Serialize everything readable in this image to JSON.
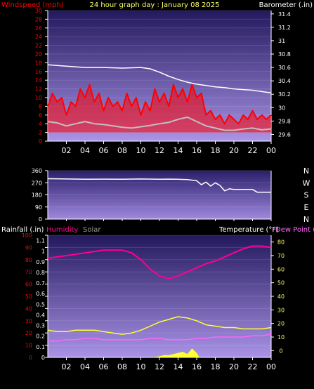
{
  "header": {
    "left_label": "Windspeed (mph)",
    "title": "24 hour graph day : January 08 2025",
    "right_label": "Barometer (.in)"
  },
  "middle_header": {
    "left_label": "Rainfall (.in)",
    "humidity_label": "Humidity",
    "solar_label": "Solar",
    "temperature_label": "Temperature (°F)",
    "dewpoint_label": "Dew Point ("
  },
  "x_tick_labels": [
    "02",
    "04",
    "06",
    "08",
    "10",
    "12",
    "14",
    "16",
    "18",
    "20",
    "22",
    "00"
  ],
  "colors": {
    "plot_top": "#23195e",
    "plot_bottom": "#a993e6",
    "wind_gust": "#ff0000",
    "wind_avg": "#c0c0c0",
    "barometer": "#ffffff",
    "direction": "#ffffff",
    "temperature": "#ff0090",
    "humidity_axis": "#ff0000",
    "dewpoint": "#ff66ff",
    "solar": "#ffff33",
    "title": "#ffff66"
  },
  "chart_data": [
    {
      "type": "line",
      "name": "wind-barometer",
      "x_range_hours": [
        0,
        24
      ],
      "left_axis": {
        "title": "Windspeed (mph)",
        "ticks": [
          "30",
          "28",
          "26",
          "24",
          "22",
          "20",
          "18",
          "16",
          "14",
          "12",
          "10",
          "8",
          "6",
          "4",
          "2",
          "0"
        ],
        "ylim": [
          0,
          30
        ]
      },
      "right_axis": {
        "title": "Barometer (.in)",
        "ticks": [
          "31.4",
          "31.2",
          "31",
          "30.8",
          "30.6",
          "30.4",
          "30.2",
          "30",
          "29.8",
          "29.6"
        ],
        "ylim": [
          29.5,
          31.45
        ]
      },
      "series": [
        {
          "label": "gust",
          "x": [
            0,
            0.5,
            1,
            1.5,
            2,
            2.5,
            3,
            3.5,
            4,
            4.5,
            5,
            5.5,
            6,
            6.5,
            7,
            7.5,
            8,
            8.5,
            9,
            9.5,
            10,
            10.5,
            11,
            11.5,
            12,
            12.5,
            13,
            13.5,
            14,
            14.5,
            15,
            15.5,
            16,
            16.5,
            17,
            17.5,
            18,
            18.5,
            19,
            19.5,
            20,
            20.5,
            21,
            21.5,
            22,
            22.5,
            23,
            23.5,
            24
          ],
          "y": [
            8,
            11,
            9,
            10,
            6,
            9,
            8,
            12,
            10,
            13,
            9,
            11,
            7,
            10,
            8,
            9,
            7,
            11,
            8,
            10,
            6,
            9,
            7,
            12,
            9,
            11,
            8,
            13,
            10,
            12,
            9,
            13,
            10,
            11,
            6,
            7,
            5,
            6,
            4,
            6,
            5,
            4,
            6,
            5,
            7,
            5,
            6,
            5,
            6
          ]
        },
        {
          "label": "average",
          "x": [
            0,
            1,
            2,
            3,
            4,
            5,
            6,
            7,
            8,
            9,
            10,
            11,
            12,
            13,
            14,
            15,
            16,
            17,
            18,
            19,
            20,
            21,
            22,
            23,
            24
          ],
          "y": [
            4.5,
            4.2,
            3.5,
            4,
            4.5,
            4,
            3.8,
            3.5,
            3.2,
            3,
            3.3,
            3.6,
            4,
            4.3,
            5,
            5.5,
            4.5,
            3.5,
            3,
            2.5,
            2.5,
            2.8,
            3,
            2.6,
            2.8
          ]
        },
        {
          "label": "barometer",
          "x": [
            0,
            2,
            4,
            6,
            8,
            10,
            11,
            12,
            13,
            14,
            15,
            16,
            17,
            18,
            19,
            20,
            21,
            22,
            23,
            24
          ],
          "y": [
            30.64,
            30.62,
            30.6,
            30.6,
            30.59,
            30.6,
            30.58,
            30.53,
            30.47,
            30.42,
            30.38,
            30.35,
            30.33,
            30.31,
            30.3,
            30.28,
            30.27,
            30.26,
            30.24,
            30.22
          ]
        }
      ]
    },
    {
      "type": "line",
      "name": "wind-direction",
      "x_range_hours": [
        0,
        24
      ],
      "left_axis": {
        "ticks": [
          "360",
          "270",
          "180",
          "90",
          "0"
        ],
        "ylim": [
          0,
          360
        ]
      },
      "right_axis": {
        "ticks": [
          "N",
          "W",
          "S",
          "E",
          "N"
        ]
      },
      "series": [
        {
          "label": "direction",
          "x": [
            0,
            2,
            4,
            6,
            8,
            10,
            12,
            13,
            14,
            15,
            16,
            16.5,
            17,
            17.5,
            18,
            18.5,
            19,
            19.5,
            20,
            21,
            22,
            22.5,
            23,
            24
          ],
          "y": [
            300,
            298,
            296,
            297,
            296,
            298,
            296,
            297,
            296,
            294,
            285,
            255,
            275,
            245,
            270,
            250,
            210,
            225,
            220,
            220,
            220,
            200,
            200,
            200
          ]
        }
      ]
    },
    {
      "type": "line",
      "name": "rain-humidity-solar-temperature",
      "x_range_hours": [
        0,
        24
      ],
      "left_axis": {
        "title": "Rainfall (.in) / Humidity",
        "outer_ticks": [
          "100",
          "90",
          "80",
          "70",
          "60",
          "50",
          "40",
          "30",
          "20",
          "10",
          "0"
        ],
        "inner_ticks": [
          "1.1",
          "1",
          "0.9",
          "0.8",
          "0.7",
          "0.6",
          "0.5",
          "0.4",
          "0.3",
          "0.2",
          "0.1",
          "0"
        ],
        "ylim": [
          0,
          100
        ]
      },
      "right_axis": {
        "title": "Temperature (°F)",
        "ticks": [
          "80",
          "70",
          "60",
          "50",
          "40",
          "30",
          "20",
          "10",
          "0"
        ],
        "ylim": [
          -5,
          85
        ]
      },
      "series": [
        {
          "label": "temperature",
          "x": [
            0,
            1,
            2,
            3,
            4,
            5,
            6,
            7,
            8,
            9,
            10,
            11,
            12,
            13,
            14,
            15,
            16,
            17,
            18,
            19,
            20,
            21,
            22,
            23,
            24
          ],
          "y": [
            68,
            69,
            70,
            71,
            72,
            73,
            74,
            74,
            74,
            72,
            67,
            60,
            55,
            53,
            55,
            58,
            61,
            64,
            66,
            69,
            72,
            75,
            77,
            77,
            76
          ]
        },
        {
          "label": "solar",
          "x": [
            0,
            1,
            2,
            3,
            4,
            5,
            6,
            7,
            8,
            9,
            10,
            11,
            12,
            13,
            14,
            15,
            16,
            17,
            18,
            19,
            20,
            21,
            22,
            23,
            24
          ],
          "y": [
            15,
            14,
            14,
            15,
            15,
            15,
            14,
            13,
            12,
            13,
            15,
            18,
            21,
            23,
            25,
            24,
            22,
            19,
            18,
            17,
            17,
            16,
            16,
            16,
            17
          ]
        },
        {
          "label": "dew point",
          "x": [
            0,
            1,
            2,
            3,
            4,
            5,
            6,
            7,
            8,
            9,
            10,
            11,
            12,
            13,
            14,
            15,
            16,
            17,
            18,
            19,
            20,
            21,
            22,
            23,
            24
          ],
          "y": [
            7,
            7,
            8,
            8,
            9,
            9,
            8,
            8,
            8,
            8,
            8,
            9,
            9,
            8,
            8,
            8,
            9,
            9,
            10,
            10,
            10,
            10,
            11,
            11,
            12
          ]
        },
        {
          "label": "solar radiation",
          "x": [
            11,
            11.5,
            12,
            12.5,
            13,
            13.5,
            14,
            14.5,
            15,
            15.5,
            16,
            16.3
          ],
          "y": [
            0,
            0.5,
            1,
            2,
            2,
            3,
            4,
            5,
            3,
            8,
            4,
            0
          ]
        }
      ]
    }
  ]
}
